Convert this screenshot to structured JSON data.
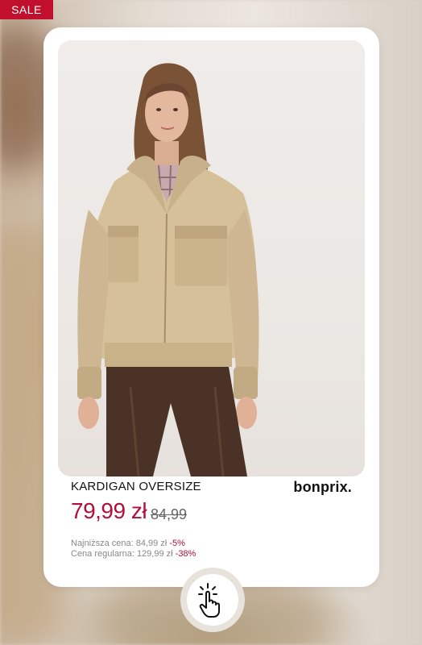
{
  "badge": {
    "label": "SALE",
    "color": "#c0102e"
  },
  "product": {
    "name": "KARDIGAN OVERSIZE",
    "brand": "bonprix.",
    "price": "79,99 zł",
    "old_price": "84,99",
    "lowest_price_label": "Najniższa cena: 84,99 zł",
    "lowest_price_discount": "-5%",
    "regular_price_label": "Cena regularna: 129,99 zł",
    "regular_price_discount": "-38%",
    "accent_color": "#b0103a"
  },
  "icons": {
    "tap": "hand-pointer-tap-icon"
  }
}
